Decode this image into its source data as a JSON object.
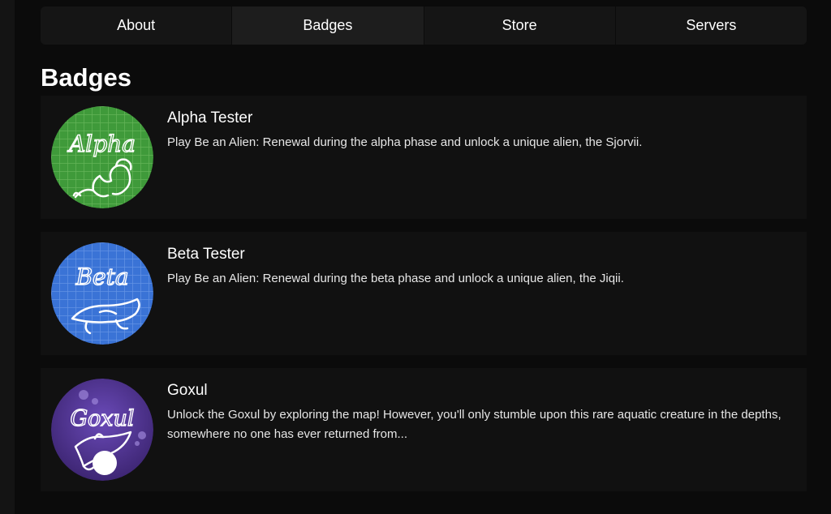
{
  "tabs": [
    {
      "label": "About",
      "active": false
    },
    {
      "label": "Badges",
      "active": true
    },
    {
      "label": "Store",
      "active": false
    },
    {
      "label": "Servers",
      "active": false
    }
  ],
  "section_title": "Badges",
  "badges": [
    {
      "name": "Alpha Tester",
      "description": "Play Be an Alien: Renewal during the alpha phase and unlock a unique alien, the Sjorvii.",
      "image_text": "Alpha",
      "color": "#3f9a3a"
    },
    {
      "name": "Beta Tester",
      "description": "Play Be an Alien: Renewal during the beta phase and unlock a unique alien, the Jiqii.",
      "image_text": "Beta",
      "color": "#3a73d6"
    },
    {
      "name": "Goxul",
      "description": "Unlock the Goxul by exploring the map! However, you'll only stumble upon this rare aquatic creature in the depths, somewhere no one has ever returned from...",
      "image_text": "Goxul",
      "color": "#5a3a9e"
    }
  ]
}
